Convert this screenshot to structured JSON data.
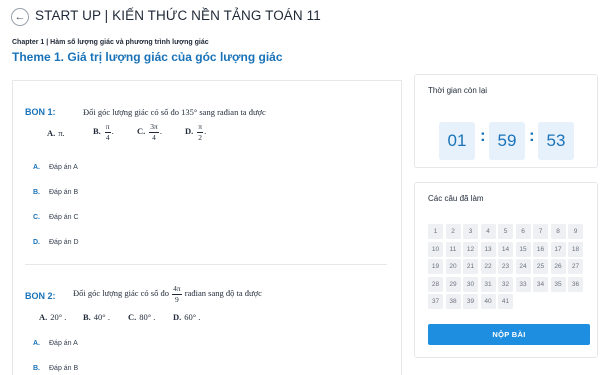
{
  "header": {
    "back_icon": "arrow-left-icon",
    "title": "START UP | KIẾN THỨC NỀN TẢNG TOÁN 11"
  },
  "breadcrumb": "Chapter 1 | Hàm số lượng giác và phương trình lượng giác",
  "theme_title": "Theme 1. Giá trị lượng giác của góc lượng giác",
  "questions": [
    {
      "label": "BON 1:",
      "text_before": "Đổi góc lượng giác có số đo 135° sang rađian ta được",
      "choices": {
        "A": {
          "letter": "A.",
          "plain": "π."
        },
        "B": {
          "letter": "B.",
          "num": "π",
          "den": "4",
          "tail": "."
        },
        "C": {
          "letter": "C.",
          "num": "3π",
          "den": "4",
          "tail": "."
        },
        "D": {
          "letter": "D.",
          "num": "π",
          "den": "2",
          "tail": "."
        }
      },
      "answers": [
        {
          "letter": "A.",
          "text": "Đáp án A"
        },
        {
          "letter": "B.",
          "text": "Đáp án B"
        },
        {
          "letter": "C.",
          "text": "Đáp án C"
        },
        {
          "letter": "D.",
          "text": "Đáp án D"
        }
      ]
    },
    {
      "label": "BON 2:",
      "text_before": "Đổi góc lượng giác có số đo",
      "frac_num": "4π",
      "frac_den": "9",
      "text_after": "rađian sang độ ta được",
      "choices": {
        "A": {
          "letter": "A.",
          "plain": "20° ."
        },
        "B": {
          "letter": "B.",
          "plain": "40° ."
        },
        "C": {
          "letter": "C.",
          "plain": "80° ."
        },
        "D": {
          "letter": "D.",
          "plain": "60° ."
        }
      },
      "answers": [
        {
          "letter": "A.",
          "text": "Đáp án A"
        },
        {
          "letter": "B.",
          "text": "Đáp án B"
        }
      ]
    }
  ],
  "timer": {
    "title": "Thời gian còn lại",
    "hours": "01",
    "minutes": "59",
    "seconds": "53",
    "separator": ":"
  },
  "answered": {
    "title": "Các câu đã làm",
    "numbers": [
      "1",
      "2",
      "3",
      "4",
      "5",
      "6",
      "7",
      "8",
      "9",
      "10",
      "11",
      "12",
      "13",
      "14",
      "15",
      "16",
      "17",
      "18",
      "19",
      "20",
      "21",
      "22",
      "23",
      "24",
      "25",
      "26",
      "27",
      "28",
      "29",
      "30",
      "31",
      "32",
      "33",
      "34",
      "35",
      "36",
      "37",
      "38",
      "39",
      "40",
      "41"
    ],
    "submit_label": "NỘP BÀI"
  },
  "colors": {
    "accent": "#1a73b8",
    "submit": "#1e8ee0",
    "timer_bg": "#e6f1fb",
    "cell_bg": "#eef0f3"
  }
}
